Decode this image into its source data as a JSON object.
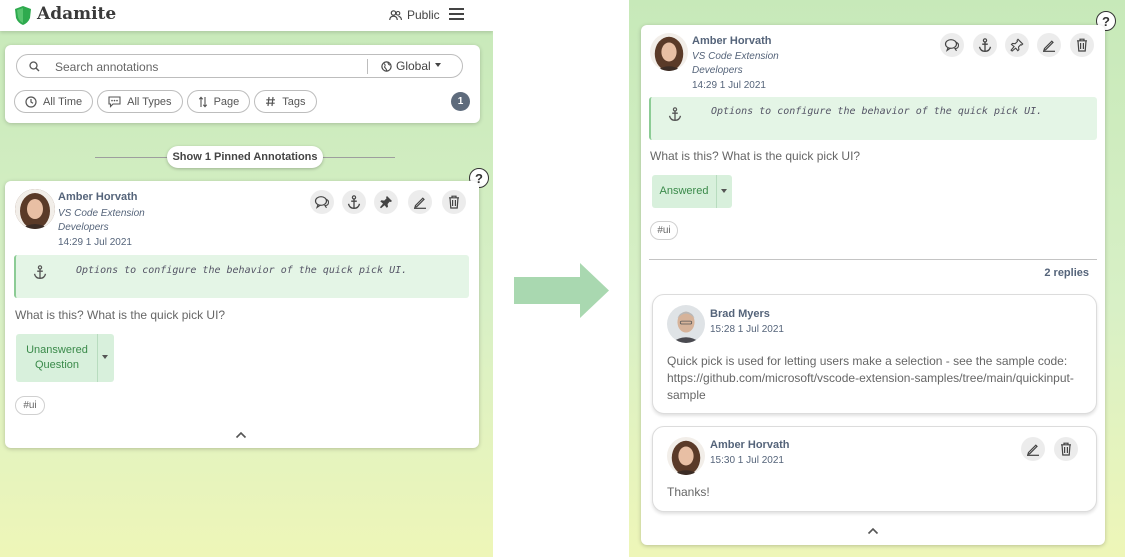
{
  "app": {
    "title": "Adamite",
    "visibility_label": "Public"
  },
  "search": {
    "placeholder": "Search annotations",
    "scope": "Global"
  },
  "filters": [
    {
      "label": "All Time",
      "icon": "clock-icon"
    },
    {
      "label": "All Types",
      "icon": "comment-dots-icon"
    },
    {
      "label": "Page",
      "icon": "sort-icon"
    },
    {
      "label": "Tags",
      "icon": "hash-icon"
    }
  ],
  "result_count": "1",
  "pinned_toggle": "Show 1 Pinned Annotations",
  "annotation": {
    "author": "Amber Horvath",
    "group_line1": "VS Code Extension",
    "group_line2": "Developers",
    "timestamp": "14:29 1 Jul 2021",
    "anchor_text": "Options to configure the behavior of the quick pick UI.",
    "question": "What is this? What is the quick pick UI?",
    "status_left_line1": "Unanswered",
    "status_left_line2": "Question",
    "status_right": "Answered",
    "tag": "#ui",
    "actions": [
      "reply-icon",
      "anchor-icon",
      "pin-icon",
      "edit-icon",
      "trash-icon"
    ]
  },
  "thread": {
    "reply_count_label": "2 replies",
    "replies": [
      {
        "author": "Brad Myers",
        "timestamp": "15:28 1 Jul 2021",
        "text_line1": "Quick pick is used for letting users make a selection - see the sample code:",
        "text_line2": "https://github.com/microsoft/vscode-extension-samples/tree/main/quickinput-",
        "text_line3": "sample"
      },
      {
        "author": "Amber Horvath",
        "timestamp": "15:30 1 Jul 2021",
        "text_line1": "Thanks!"
      }
    ]
  },
  "help_label": "?",
  "colors": {
    "status_green_bg": "#d8f0dc",
    "status_green_text": "#3a8a4a",
    "badge": "#5e6b7c",
    "arrow": "#a9d8b0"
  }
}
